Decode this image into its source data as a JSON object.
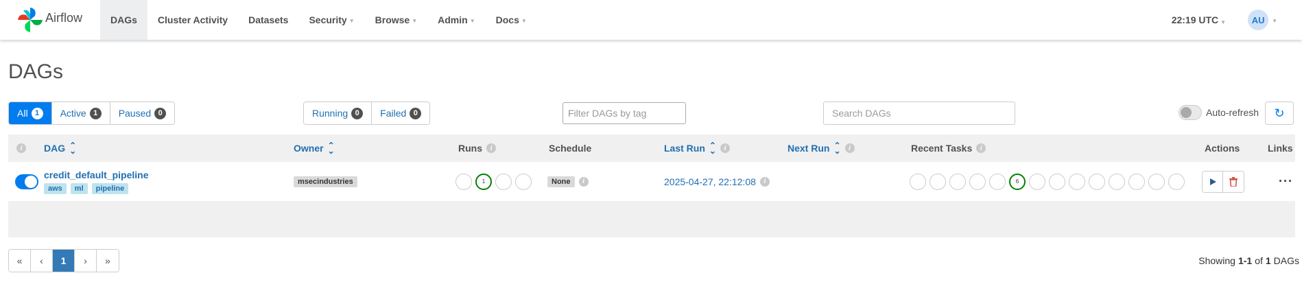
{
  "brand": {
    "name": "Airflow"
  },
  "nav": {
    "items": [
      {
        "label": "DAGs",
        "dropdown": false,
        "active": true
      },
      {
        "label": "Cluster Activity",
        "dropdown": false
      },
      {
        "label": "Datasets",
        "dropdown": false
      },
      {
        "label": "Security",
        "dropdown": true
      },
      {
        "label": "Browse",
        "dropdown": true
      },
      {
        "label": "Admin",
        "dropdown": true
      },
      {
        "label": "Docs",
        "dropdown": true
      }
    ],
    "clock": "22:19 UTC",
    "avatar_initials": "AU"
  },
  "page": {
    "title": "DAGs"
  },
  "filters": {
    "status": [
      {
        "label": "All",
        "count": "1",
        "active": true
      },
      {
        "label": "Active",
        "count": "1"
      },
      {
        "label": "Paused",
        "count": "0"
      }
    ],
    "state": [
      {
        "label": "Running",
        "count": "0"
      },
      {
        "label": "Failed",
        "count": "0"
      }
    ],
    "tag_placeholder": "Filter DAGs by tag",
    "search_placeholder": "Search DAGs",
    "auto_refresh_label": "Auto-refresh"
  },
  "table": {
    "headers": {
      "dag": "DAG",
      "owner": "Owner",
      "runs": "Runs",
      "schedule": "Schedule",
      "last_run": "Last Run",
      "next_run": "Next Run",
      "recent_tasks": "Recent Tasks",
      "actions": "Actions",
      "links": "Links"
    },
    "rows": [
      {
        "dag_id": "credit_default_pipeline",
        "tags": [
          "aws",
          "ml",
          "pipeline"
        ],
        "owner": "msecindustries",
        "runs_success_count": "1",
        "schedule": "None",
        "last_run": "2025-04-27, 22:12:08",
        "next_run": "",
        "recent_tasks_success_count": "6"
      }
    ]
  },
  "pagination": {
    "first": "«",
    "prev": "‹",
    "current": "1",
    "next": "›",
    "last": "»"
  },
  "showing": {
    "prefix": "Showing",
    "range": "1-1",
    "of": "of",
    "total": "1",
    "suffix": "DAGs"
  },
  "colors": {
    "accent": "#017cee",
    "success": "#008000",
    "link": "#1f6fb2"
  }
}
